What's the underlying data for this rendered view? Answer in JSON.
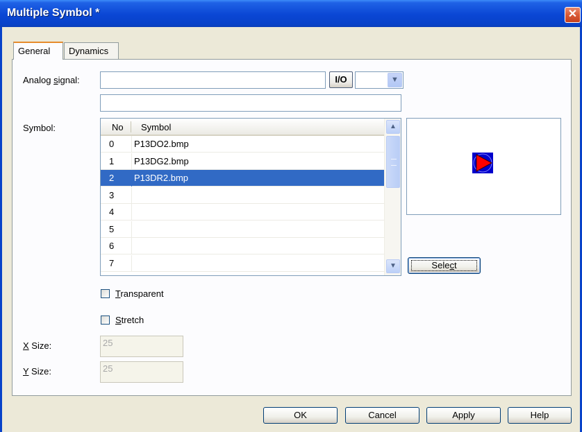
{
  "window": {
    "title": "Multiple Symbol *",
    "close_glyph": "✕"
  },
  "tabs": [
    {
      "label": "General",
      "active": true
    },
    {
      "label": "Dynamics",
      "active": false
    }
  ],
  "analog_signal": {
    "label_pre": "Analog ",
    "label_mnemonic": "s",
    "label_post": "ignal:",
    "value": "",
    "secondary_value": "",
    "io_button_label": "I/O",
    "combo_value": ""
  },
  "symbol": {
    "label": "Symbol:",
    "columns": [
      "No",
      "Symbol"
    ],
    "rows": [
      {
        "no": "0",
        "symbol": "P13DO2.bmp",
        "selected": false
      },
      {
        "no": "1",
        "symbol": "P13DG2.bmp",
        "selected": false
      },
      {
        "no": "2",
        "symbol": "P13DR2.bmp",
        "selected": true
      },
      {
        "no": "3",
        "symbol": "",
        "selected": false
      },
      {
        "no": "4",
        "symbol": "",
        "selected": false
      },
      {
        "no": "5",
        "symbol": "",
        "selected": false
      },
      {
        "no": "6",
        "symbol": "",
        "selected": false
      },
      {
        "no": "7",
        "symbol": "",
        "selected": false
      }
    ],
    "select_button": {
      "pre": "Sele",
      "mnemonic": "c",
      "post": "t"
    },
    "preview_icon": "pump-symbol-icon"
  },
  "options": {
    "transparent": {
      "mnemonic": "T",
      "rest": "ransparent",
      "checked": false
    },
    "stretch": {
      "mnemonic": "S",
      "rest": "tretch",
      "checked": false
    }
  },
  "size": {
    "x_label_mnemonic": "X",
    "x_label_rest": " Size:",
    "x_value": "25",
    "y_label_mnemonic": "Y",
    "y_label_rest": " Size:",
    "y_value": "25"
  },
  "buttons": {
    "ok": "OK",
    "cancel": "Cancel",
    "apply": "Apply",
    "help": "Help"
  },
  "colors": {
    "titlebar": "#0842c9",
    "selection": "#316ac5",
    "icon_bg": "#0000cc",
    "icon_arrow": "#ff0000"
  }
}
